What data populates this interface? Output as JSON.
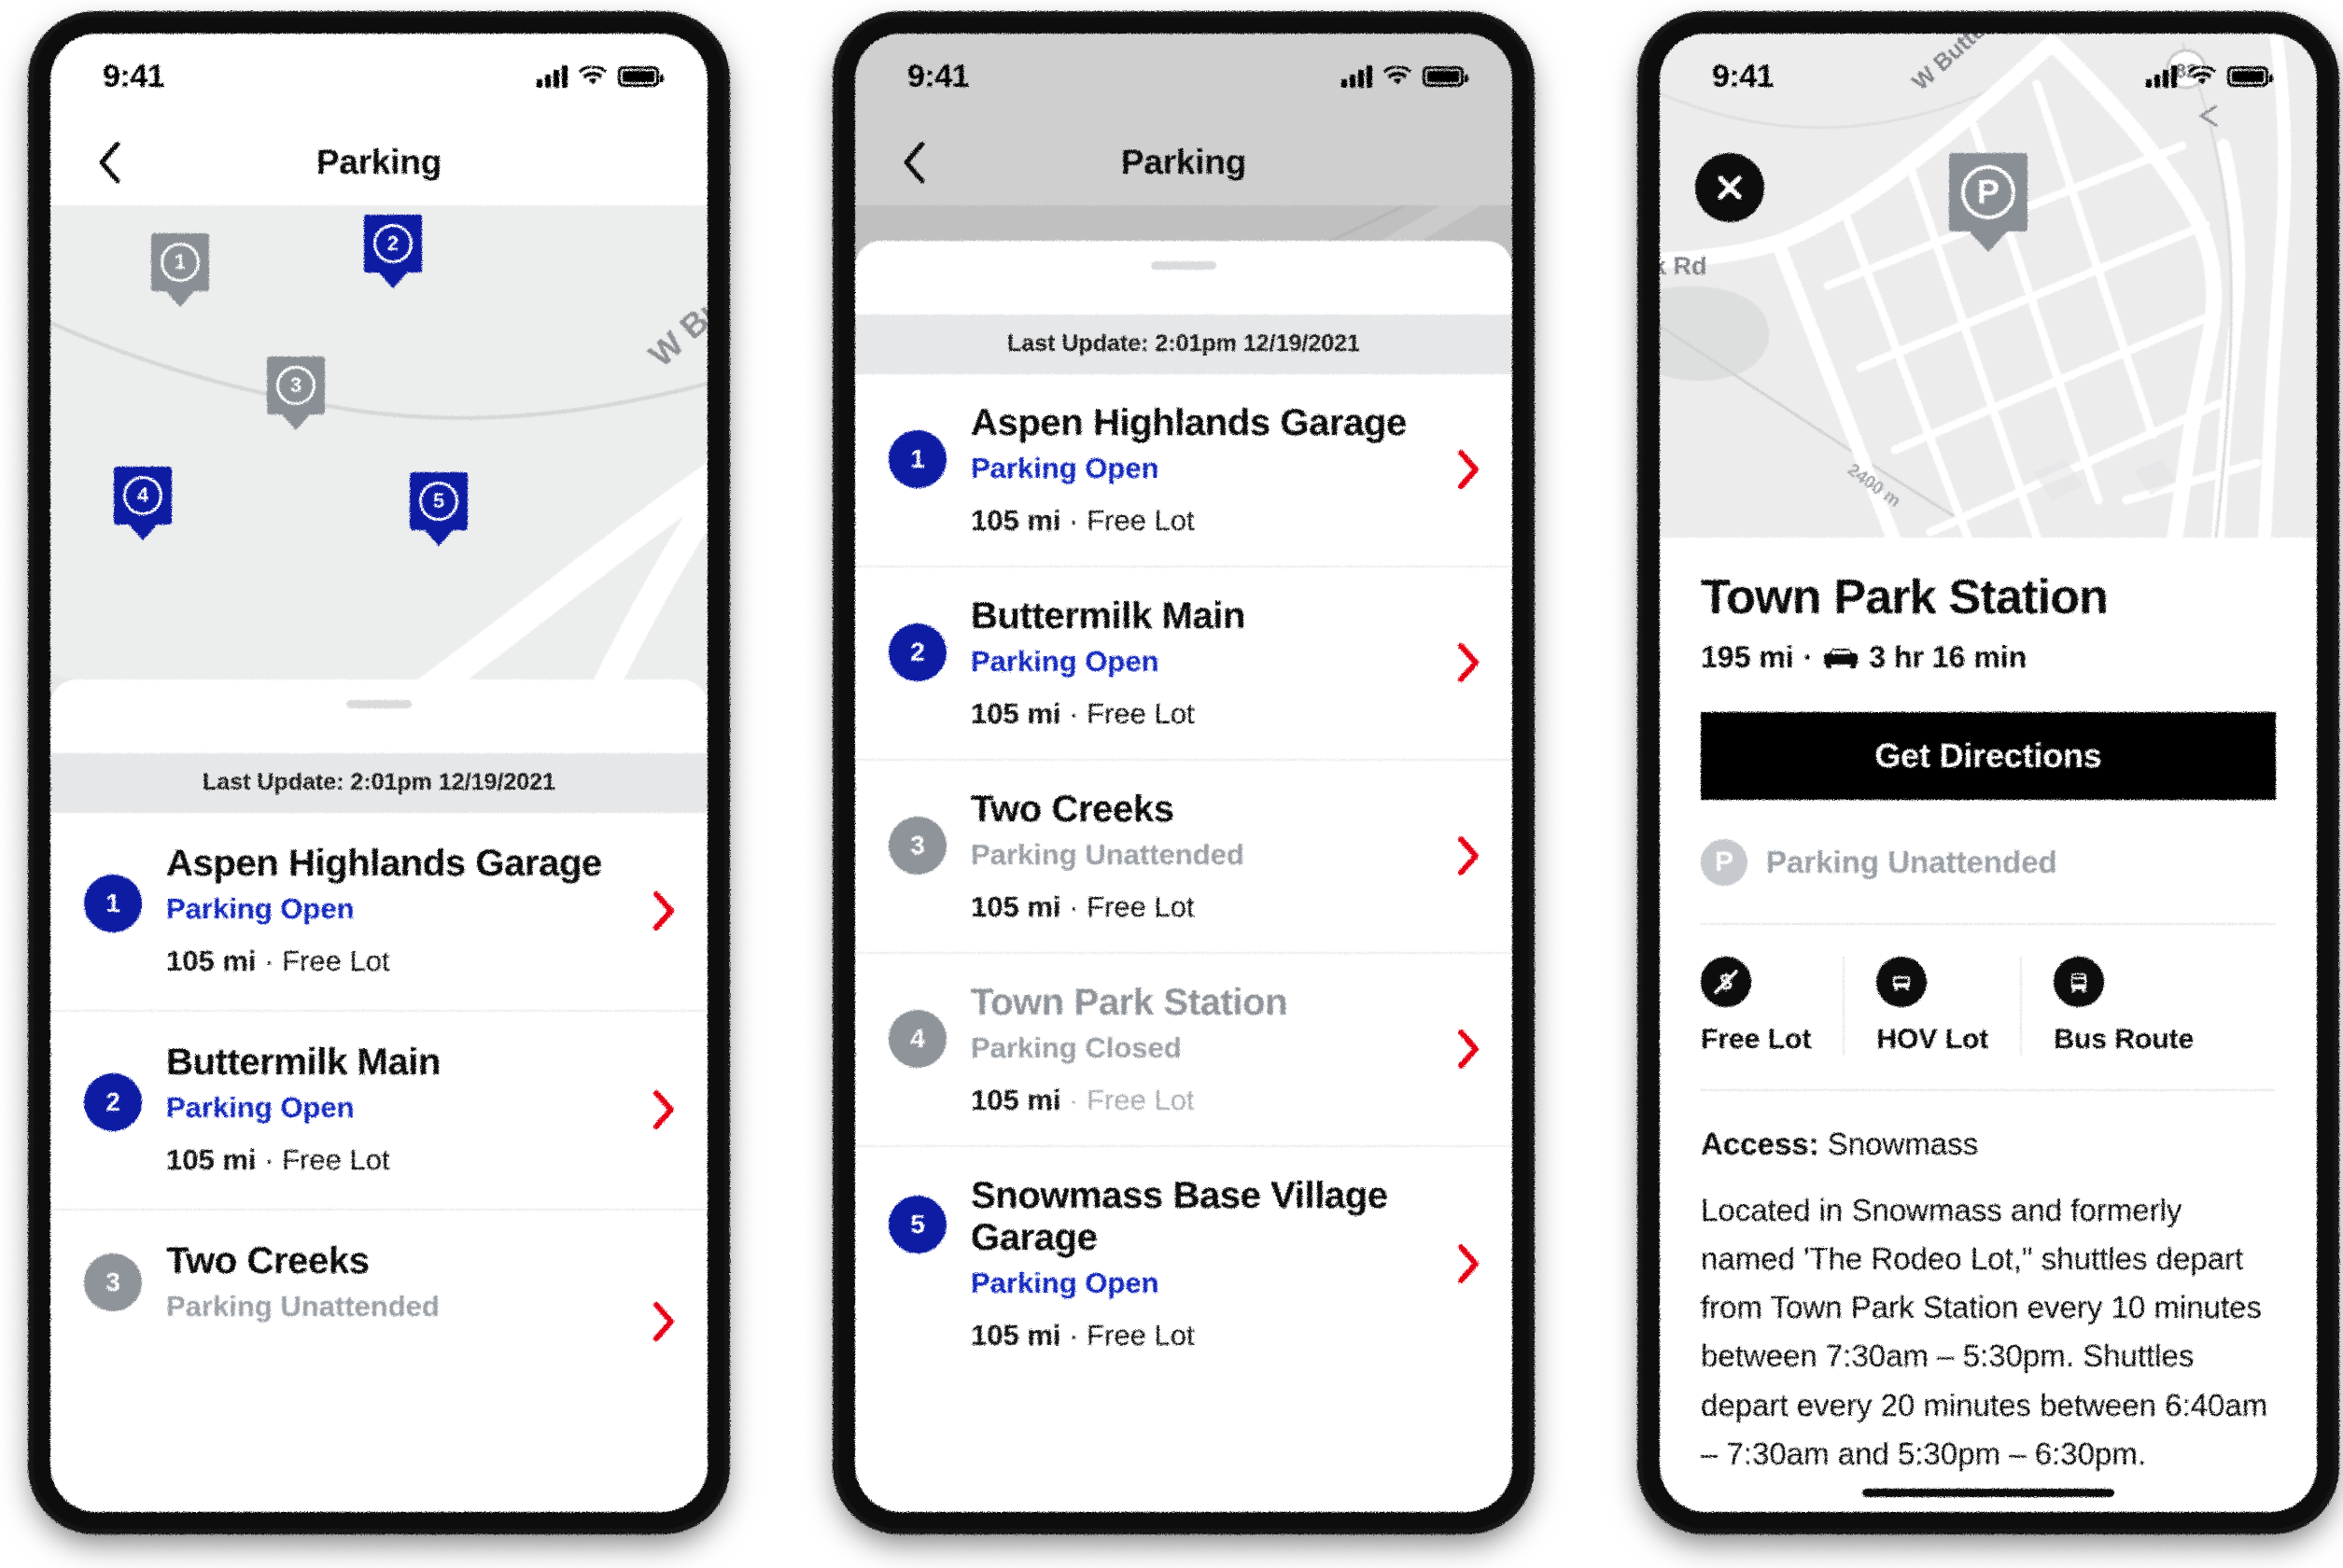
{
  "status_bar": {
    "time": "9:41",
    "signal_icon": "cellular-bars-icon",
    "wifi_icon": "wifi-icon",
    "battery_icon": "battery-full-icon"
  },
  "screens": [
    {
      "id": "parking-map-list",
      "nav": {
        "title": "Parking",
        "back_icon": "chevron-left-icon"
      },
      "sheet": {
        "last_update": "Last Update: 2:01pm 12/19/2021"
      }
    },
    {
      "id": "parking-list-expanded",
      "nav": {
        "title": "Parking",
        "back_icon": "chevron-left-icon"
      },
      "sheet": {
        "last_update": "Last Update: 2:01pm 12/19/2021"
      }
    },
    {
      "id": "parking-detail",
      "close_icon": "close-x-icon"
    }
  ],
  "lots": [
    {
      "index": "1",
      "name": "Aspen Highlands Garage",
      "status": "Parking Open",
      "status_state": "open",
      "distance": "105 mi",
      "separator": "·",
      "type": "Free Lot"
    },
    {
      "index": "2",
      "name": "Buttermilk Main",
      "status": "Parking Open",
      "status_state": "open",
      "distance": "105 mi",
      "separator": "·",
      "type": "Free Lot"
    },
    {
      "index": "3",
      "name": "Two Creeks",
      "status": "Parking Unattended",
      "status_state": "unattended",
      "distance": "105 mi",
      "separator": "·",
      "type": "Free Lot"
    },
    {
      "index": "4",
      "name": "Town Park Station",
      "status": "Parking Closed",
      "status_state": "closed",
      "distance": "105 mi",
      "separator": "·",
      "type": "Free Lot"
    },
    {
      "index": "5",
      "name": "Snowmass Base Village Garage",
      "status": "Parking Open",
      "status_state": "open",
      "distance": "105 mi",
      "separator": "·",
      "type": "Free Lot"
    }
  ],
  "map": {
    "labels": {
      "road_buttermilk": "W Buttermilk Rd",
      "road_creek": "ek Rd",
      "road_creek_detail": "k Rd",
      "contour": "2400 m",
      "highway_shield": "82"
    },
    "pins": [
      {
        "index": "1",
        "state": "inactive"
      },
      {
        "index": "2",
        "state": "active"
      },
      {
        "index": "3",
        "state": "inactive"
      },
      {
        "index": "4",
        "state": "active"
      },
      {
        "index": "5",
        "state": "active"
      }
    ],
    "detail_pin_glyph": "P"
  },
  "detail": {
    "title": "Town Park Station",
    "distance": "195 mi",
    "separator": "·",
    "drive_icon": "car-icon",
    "duration": "3 hr 16 min",
    "directions_button": "Get Directions",
    "parking_status": "Parking Unattended",
    "parking_glyph": "P",
    "amenities": [
      {
        "icon": "free-lot-icon",
        "label": "Free Lot"
      },
      {
        "icon": "hov-lot-icon",
        "label": "HOV Lot"
      },
      {
        "icon": "bus-route-icon",
        "label": "Bus Route"
      }
    ],
    "access_label": "Access:",
    "access_value": "Snowmass",
    "description": "Located in Snowmass and formerly named 'The Rodeo Lot,\" shuttles depart from Town Park Station every 10 minutes between 7:30am – 5:30pm. Shuttles depart every 20 minutes between 6:40am – 7:30am and 5:30pm – 6:30pm."
  },
  "colors": {
    "brand_blue": "#0a1ba3",
    "status_blue": "#172bbd",
    "chevron_red": "#e60012",
    "muted_gray": "#9aa0a6",
    "pin_gray": "#8a8f95",
    "map_bg": "#eceded"
  }
}
